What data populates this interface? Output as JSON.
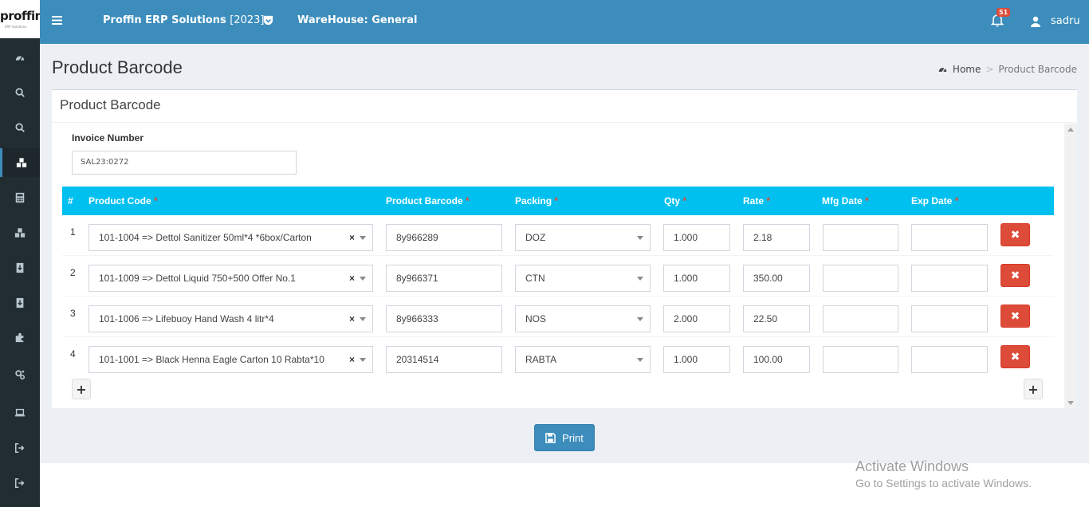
{
  "header": {
    "logo_text": "proffin",
    "logo_sub": "ERP Solutions",
    "app_name": "Proffin ERP Solutions",
    "app_year": "[2023]",
    "warehouse": "WareHouse: General",
    "notification_count": "51",
    "user_name": "sadru"
  },
  "sidebar": {
    "items": [
      {
        "icon": "dashboard-icon"
      },
      {
        "icon": "search-icon"
      },
      {
        "icon": "search-icon"
      },
      {
        "icon": "cubes-icon",
        "active": true
      },
      {
        "icon": "calculator-icon"
      },
      {
        "icon": "cubes-icon"
      },
      {
        "icon": "download-icon"
      },
      {
        "icon": "download-icon"
      },
      {
        "icon": "puzzle-icon"
      },
      {
        "icon": "cogs-icon"
      },
      {
        "icon": "laptop-icon"
      },
      {
        "icon": "sign-out-icon"
      },
      {
        "icon": "sign-out-icon"
      }
    ]
  },
  "page": {
    "title": "Product Barcode",
    "breadcrumb_home": "Home",
    "breadcrumb_sep": ">",
    "breadcrumb_current": "Product Barcode"
  },
  "box": {
    "title": "Product Barcode",
    "invoice_label": "Invoice Number",
    "invoice_value": "SAL23:0272"
  },
  "table": {
    "headers": {
      "num": "#",
      "code": "Product Code",
      "barcode": "Product Barcode",
      "packing": "Packing",
      "qty": "Qty",
      "rate": "Rate",
      "mfg": "Mfg Date",
      "exp": "Exp Date"
    },
    "required_mark": "*",
    "rows": [
      {
        "num": "1",
        "code": "101-1004 =>  Dettol Sanitizer 50ml*4 *6box/Carton",
        "barcode": "8y966289",
        "packing": "DOZ",
        "qty": "1.000",
        "rate": "2.18",
        "mfg": "",
        "exp": ""
      },
      {
        "num": "2",
        "code": "101-1009 =>  Dettol Liquid 750+500 Offer No.1",
        "barcode": "8y966371",
        "packing": "CTN",
        "qty": "1.000",
        "rate": "350.00",
        "mfg": "",
        "exp": ""
      },
      {
        "num": "3",
        "code": "101-1006 =>  Lifebuoy Hand Wash 4 litr*4",
        "barcode": "8y966333",
        "packing": "NOS",
        "qty": "2.000",
        "rate": "22.50",
        "mfg": "",
        "exp": ""
      },
      {
        "num": "4",
        "code": "101-1001 =>  Black Henna Eagle Carton 10 Rabta*10",
        "barcode": "20314514",
        "packing": "RABTA",
        "qty": "1.000",
        "rate": "100.00",
        "mfg": "",
        "exp": ""
      }
    ],
    "clear_symbol": "×",
    "delete_symbol": "✖",
    "add_symbol": "+"
  },
  "actions": {
    "print_label": "Print"
  },
  "watermark": {
    "line1": "Activate Windows",
    "line2": "Go to Settings to activate Windows."
  },
  "colors": {
    "header": "#3c8dbc",
    "sidebar": "#222d32",
    "table_head": "#00c0ef",
    "danger": "#dd4b39",
    "content_bg": "#ecf0f5"
  }
}
